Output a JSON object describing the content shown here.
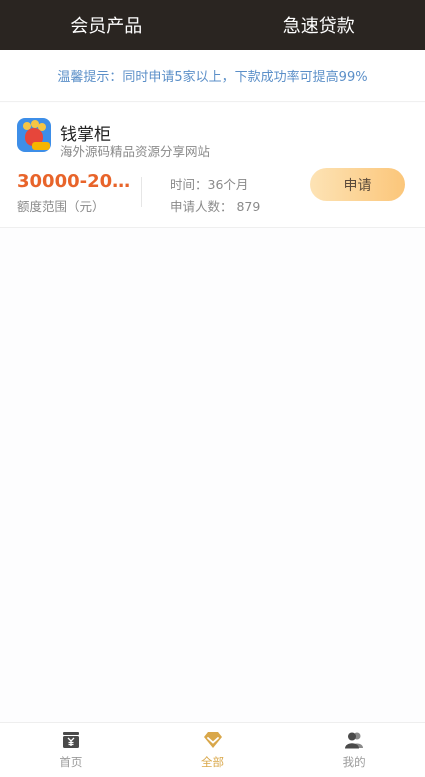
{
  "header": {
    "tabs": [
      {
        "label": "会员产品"
      },
      {
        "label": "急速贷款"
      }
    ]
  },
  "notice": {
    "text": "温馨提示：同时申请5家以上，下款成功率可提高99%"
  },
  "product": {
    "name": "钱掌柜",
    "description": "海外源码精品资源分享网站",
    "amount": "30000-2000...",
    "amount_label": "额度范围（元）",
    "time_text": "时间：36个月",
    "applicants_text": "申请人数： 879",
    "apply_label": "申请"
  },
  "bottom_nav": {
    "items": [
      {
        "label": "首页",
        "icon": "home-icon"
      },
      {
        "label": "全部",
        "icon": "diamond-icon"
      },
      {
        "label": "我的",
        "icon": "user-icon"
      }
    ]
  },
  "colors": {
    "header_bg": "#2a2521",
    "notice_text": "#5b8fc8",
    "amount": "#e8642a",
    "button_gradient_start": "#fde3b5",
    "button_gradient_end": "#fbc67a",
    "nav_active": "#d9a74a",
    "nav_inactive": "#9a9a9a"
  }
}
